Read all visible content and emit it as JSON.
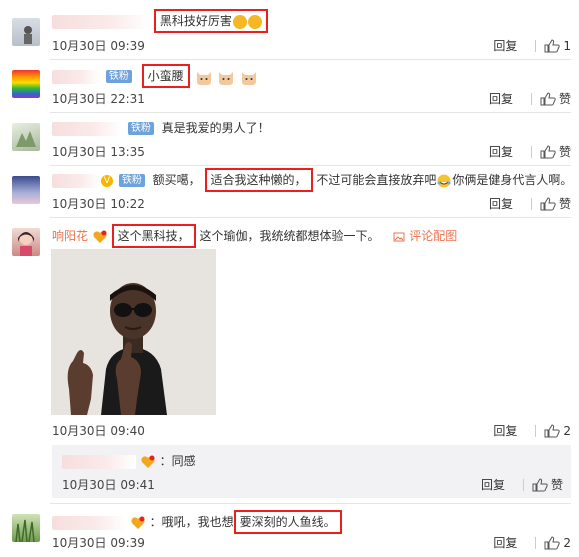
{
  "comments": [
    {
      "text": "黑科技好厉害",
      "time": "10月30日 09:39",
      "reply": "回复",
      "likes": "1"
    },
    {
      "badge": "铁粉",
      "text": "小蛮腰",
      "time": "10月30日 22:31",
      "reply": "回复",
      "like_label": "赞"
    },
    {
      "badge": "铁粉",
      "text": "真是我爱的男人了！",
      "time": "10月30日 13:35",
      "reply": "回复",
      "like_label": "赞"
    },
    {
      "badge": "铁粉",
      "text_before": "额买噶，",
      "text_highlight": "适合我这种懒的，",
      "text_after": "不过可能会直接放弃吧",
      "text_after2": "你俩是健身代言人啊。",
      "time": "10月30日 10:22",
      "reply": "回复",
      "like_label": "赞"
    },
    {
      "username": "响阳花",
      "text_highlight": "这个黑科技，",
      "text_after": "这个瑜伽，我统统都想体验一下。",
      "image_link": "评论配图",
      "time": "10月30日 09:40",
      "reply": "回复",
      "likes": "2",
      "sub_reply": {
        "text": "：同感",
        "time": "10月30日 09:41",
        "reply": "回复",
        "like_label": "赞"
      }
    },
    {
      "text_before": "：哦吼，我也想",
      "text_highlight": "要深刻的人鱼线。",
      "time": "10月30日 09:39",
      "reply": "回复",
      "likes": "2"
    }
  ],
  "colors": {
    "highlight_box": "#e8201e",
    "fan_badge": "#6da2dc",
    "username_orange": "#eb7350",
    "reply_bg": "#f2f2f5"
  }
}
